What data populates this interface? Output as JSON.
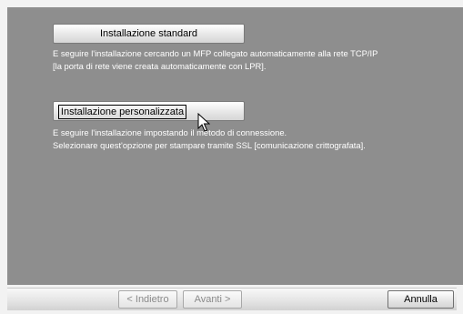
{
  "options": {
    "standard": {
      "label": "Installazione standard",
      "description_line1": "E seguire l'installazione cercando un MFP collegato automaticamente alla rete TCP/IP",
      "description_line2": "[la porta di rete viene creata automaticamente con LPR]."
    },
    "custom": {
      "label": "Installazione personalizzata",
      "description_line1": "E seguire l'installazione impostando il metodo di connessione.",
      "description_line2": "Selezionare quest'opzione per stampare tramite SSL [comunicazione crittografata]."
    }
  },
  "footer": {
    "back_label": "< Indietro",
    "next_label": "Avanti >",
    "cancel_label": "Annulla"
  },
  "colors": {
    "panel_background": "#8e8e8e",
    "description_text": "#ffffff",
    "disabled_text": "#8a8a8a"
  },
  "icons": {
    "cursor": "mouse-pointer-icon"
  }
}
